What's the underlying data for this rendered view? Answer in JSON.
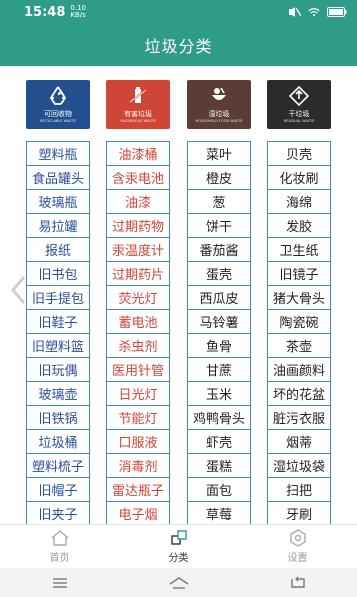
{
  "status": {
    "time": "15:48",
    "speed_value": "0.10",
    "speed_unit": "KB/s",
    "icons": [
      "mute-icon",
      "wifi-icon",
      "battery-icon"
    ]
  },
  "title": "垃圾分类",
  "categories": [
    {
      "name": "可回收物",
      "en": "RECYCLABLE WASTE",
      "color": "#234f8f",
      "icon": "recycle-icon"
    },
    {
      "name": "有害垃圾",
      "en": "HAZARDOUS WASTE",
      "color": "#cf4536",
      "icon": "hazard-icon"
    },
    {
      "name": "湿垃圾",
      "en": "HOUSEHOLD FOOD WASTE",
      "color": "#5a3e35",
      "icon": "food-waste-icon"
    },
    {
      "name": "干垃圾",
      "en": "RESIDUAL WASTE",
      "color": "#2b2b2b",
      "icon": "residual-icon"
    }
  ],
  "columns": {
    "recyclable": [
      "塑料瓶",
      "食品罐头",
      "玻璃瓶",
      "易拉罐",
      "报纸",
      "旧书包",
      "旧手提包",
      "旧鞋子",
      "旧塑料篮",
      "旧玩偶",
      "玻璃壶",
      "旧铁锅",
      "垃圾桶",
      "塑料梳子",
      "旧帽子",
      "旧夹子"
    ],
    "hazardous": [
      "油漆桶",
      "含汞电池",
      "油漆",
      "过期药物",
      "汞温度计",
      "过期药片",
      "荧光灯",
      "蓄电池",
      "杀虫剂",
      "医用针管",
      "日光灯",
      "节能灯",
      "口服液",
      "消毒剂",
      "雷达瓶子",
      "电子烟"
    ],
    "wet": [
      "菜叶",
      "橙皮",
      "葱",
      "饼干",
      "番茄酱",
      "蛋壳",
      "西瓜皮",
      "马铃薯",
      "鱼骨",
      "甘蔗",
      "玉米",
      "鸡鸭骨头",
      "虾壳",
      "蛋糕",
      "面包",
      "草莓"
    ],
    "dry": [
      "贝壳",
      "化妆刷",
      "海绵",
      "发胶",
      "卫生纸",
      "旧镜子",
      "猪大骨头",
      "陶瓷碗",
      "茶壶",
      "油画颜料",
      "坏的花盆",
      "脏污衣服",
      "烟蒂",
      "湿垃圾袋",
      "扫把",
      "牙刷"
    ]
  },
  "tabs": [
    {
      "label": "首页",
      "icon": "home-icon",
      "active": false
    },
    {
      "label": "分类",
      "icon": "category-icon",
      "active": true
    },
    {
      "label": "设置",
      "icon": "settings-icon",
      "active": false
    }
  ],
  "nav": [
    "menu-icon",
    "home-nav-icon",
    "back-icon"
  ]
}
